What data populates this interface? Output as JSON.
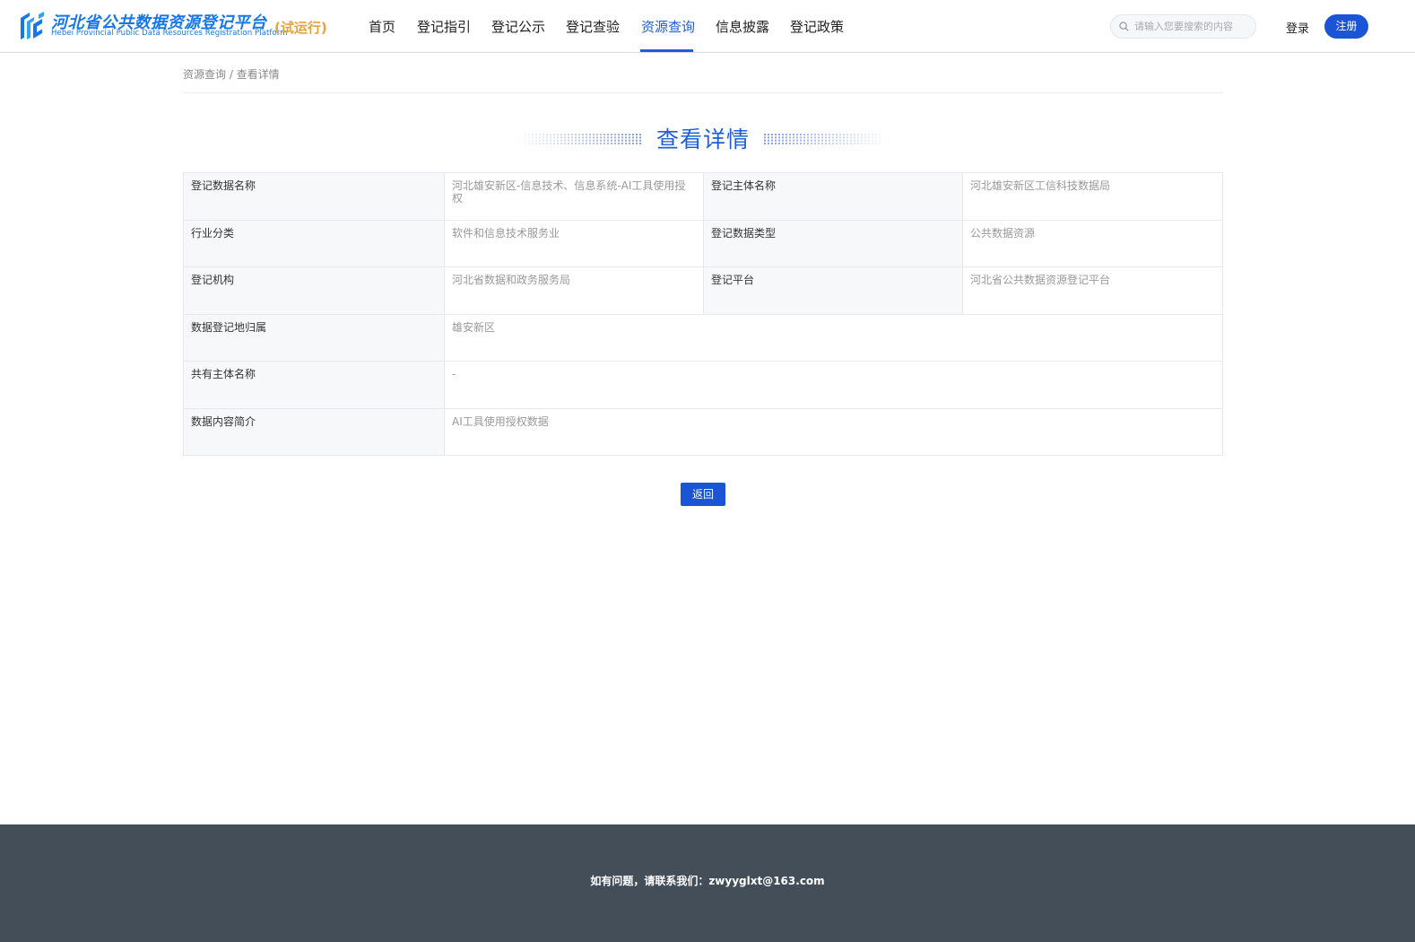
{
  "header": {
    "logo_title": "河北省公共数据资源登记平台",
    "logo_subtitle": "Hebei Provincial Public Data Resources Registration Platform",
    "logo_trial": "(试运行)",
    "nav": [
      {
        "label": "首页"
      },
      {
        "label": "登记指引"
      },
      {
        "label": "登记公示"
      },
      {
        "label": "登记查验"
      },
      {
        "label": "资源查询",
        "active": true
      },
      {
        "label": "信息披露"
      },
      {
        "label": "登记政策"
      }
    ],
    "search_placeholder": "请输入您要搜索的内容",
    "login_label": "登录",
    "register_label": "注册"
  },
  "breadcrumb": "资源查询 / 查看详情",
  "page_title": "查看详情",
  "detail": {
    "rows": [
      {
        "l1": "登记数据名称",
        "v1": "河北雄安新区-信息技术、信息系统-AI工具使用授权",
        "l2": "登记主体名称",
        "v2": "河北雄安新区工信科技数据局"
      },
      {
        "l1": "行业分类",
        "v1": "软件和信息技术服务业",
        "l2": "登记数据类型",
        "v2": "公共数据资源"
      },
      {
        "l1": "登记机构",
        "v1": "河北省数据和政务服务局",
        "l2": "登记平台",
        "v2": "河北省公共数据资源登记平台"
      },
      {
        "l1": "数据登记地归属",
        "v1": "雄安新区"
      },
      {
        "l1": "共有主体名称",
        "v1": "-"
      },
      {
        "l1": "数据内容简介",
        "v1": "AI工具使用授权数据"
      }
    ]
  },
  "back_label": "返回",
  "footer_text": "如有问题，请联系我们：zwyyglxt@163.com",
  "colors": {
    "primary": "#1e5fdc",
    "button": "#1a55d6",
    "trial": "#e7a23c",
    "footer_bg": "#434e59"
  }
}
